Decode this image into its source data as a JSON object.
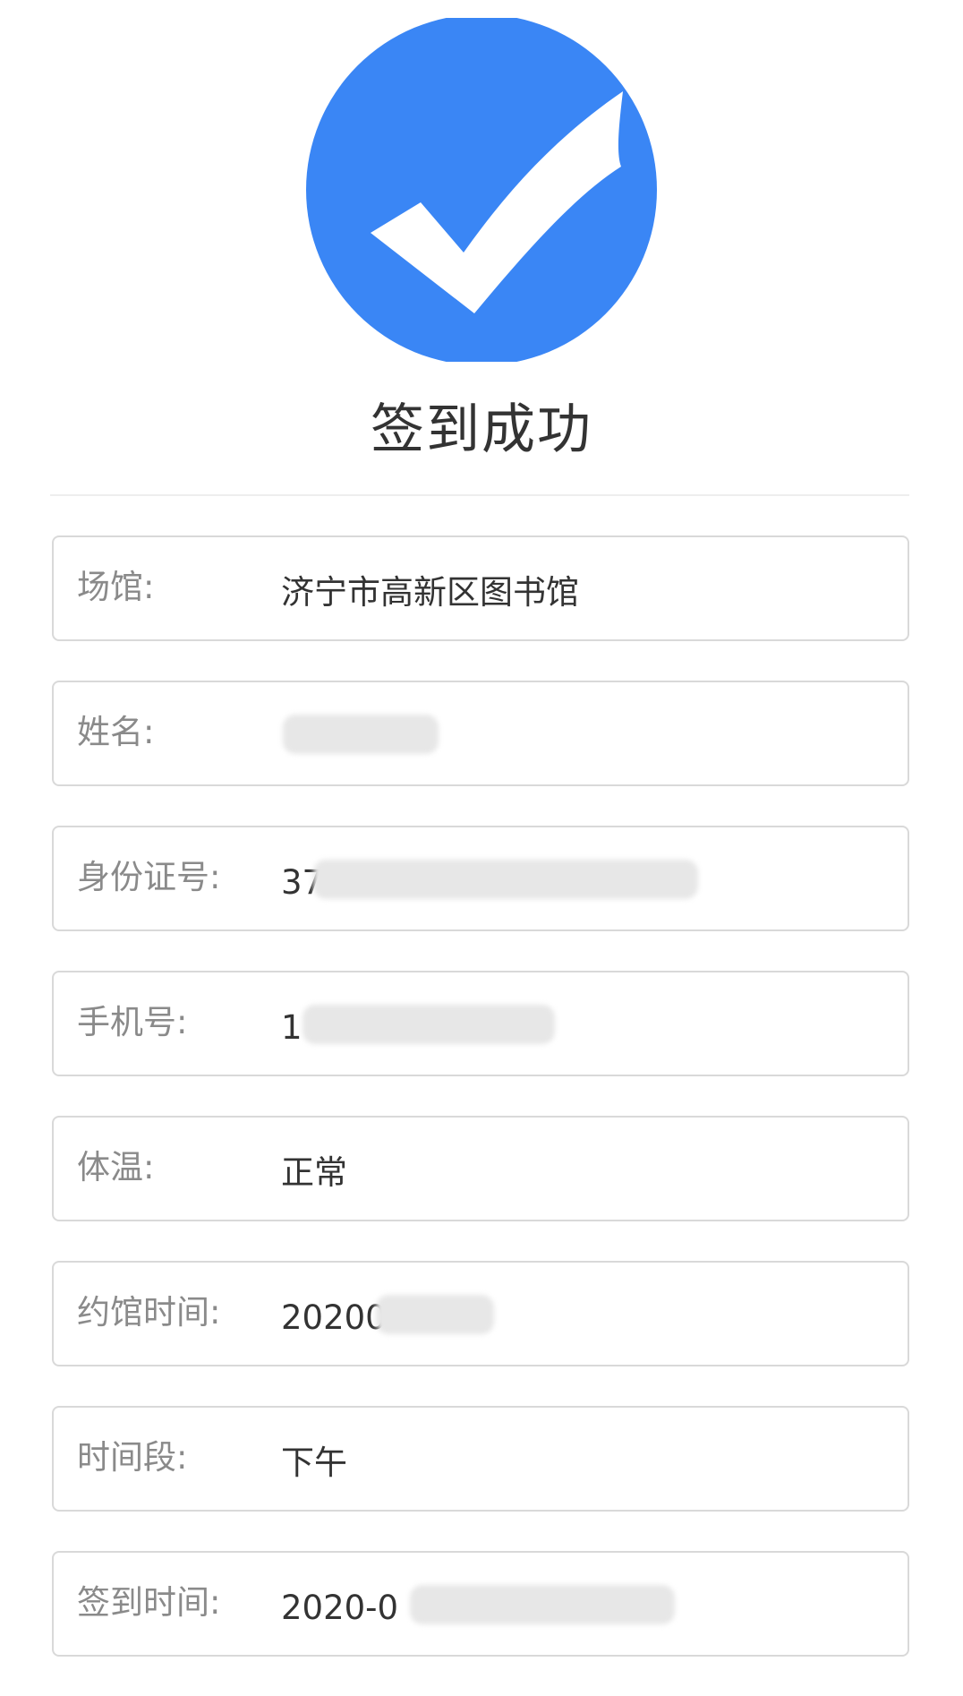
{
  "header": {
    "icon": "check-circle-icon",
    "icon_color": "#3A86F5",
    "title": "签到成功"
  },
  "info": {
    "venue": {
      "label": "场馆:",
      "value": "济宁市高新区图书馆"
    },
    "name": {
      "label": "姓名:",
      "value": ""
    },
    "id_number": {
      "label": "身份证号:",
      "value": "37"
    },
    "phone": {
      "label": "手机号:",
      "value": "1"
    },
    "temperature": {
      "label": "体温:",
      "value": "正常"
    },
    "booking_date": {
      "label": "约馆时间:",
      "value": "20200"
    },
    "time_slot": {
      "label": "时间段:",
      "value": "下午"
    },
    "checkin_time": {
      "label": "签到时间:",
      "value": "2020-0"
    }
  },
  "colors": {
    "accent": "#3A86F5",
    "border": "#D9D9D9",
    "label": "#8A8A8A",
    "value": "#333333"
  }
}
